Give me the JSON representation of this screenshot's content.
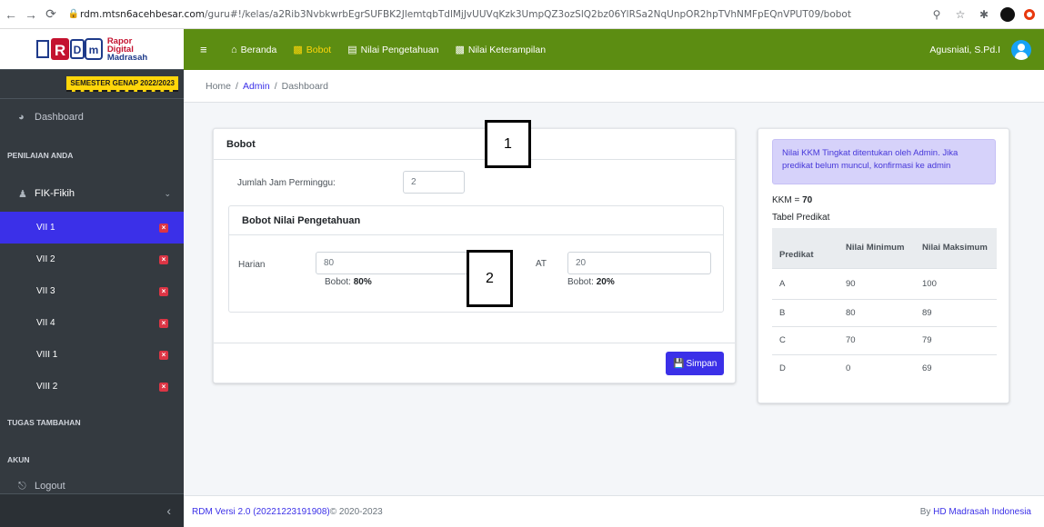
{
  "browser": {
    "url_host": "rdm.mtsn6acehbesar.com",
    "url_path": "/guru#!/kelas/a2Rib3NvbkwrbEgrSUFBK2JlemtqbTdlMjJvUUVqKzk3UmpQZ3ozSlQ2bz06YlRSa2NqUnpOR2hpTVhNMFpEQnVPUT09/bobot",
    "back_icon": "back-arrow-icon",
    "forward_icon": "forward-arrow-icon",
    "reload_icon": "reload-icon"
  },
  "brand": {
    "logo_letters": "RDM",
    "line1": "Rapor",
    "line2": "Digital",
    "line3": "Madrasah"
  },
  "sidebar": {
    "semester": "SEMESTER GENAP 2022/2023",
    "dashboard": "Dashboard",
    "section_penilaian": "PENILAIAN ANDA",
    "group_label": "FIK-Fikih",
    "classes": [
      "VII 1",
      "VII 2",
      "VII 3",
      "VII 4",
      "VIII 1",
      "VIII 2"
    ],
    "section_tugas": "TUGAS TAMBAHAN",
    "section_akun": "AKUN",
    "logout": "Logout"
  },
  "topnav": {
    "beranda": "Beranda",
    "bobot": "Bobot",
    "nilai_pengetahuan": "Nilai Pengetahuan",
    "nilai_keterampilan": "Nilai Keterampilan",
    "user_name": "Agusniati, S.Pd.I"
  },
  "breadcrumb": {
    "home": "Home",
    "admin": "Admin",
    "current": "Dashboard",
    "sep": "/"
  },
  "bobot_card": {
    "title": "Bobot",
    "jam_label": "Jumlah Jam Perminggu:",
    "jam_value": "2",
    "pengetahuan_title": "Bobot Nilai Pengetahuan",
    "harian_label": "Harian",
    "harian_value": "80",
    "harian_bobot_prefix": "Bobot: ",
    "harian_bobot_value": "80%",
    "pat_label": "AT",
    "pat_value": "20",
    "pat_bobot_prefix": "Bobot: ",
    "pat_bobot_value": "20%",
    "save_label": "Simpan"
  },
  "info_card": {
    "alert": "Nilai KKM Tingkat ditentukan oleh Admin. Jika predikat belum muncul, konfirmasi ke admin",
    "kkm_prefix": "KKM = ",
    "kkm_value": "70",
    "table_title": "Tabel Predikat",
    "headers": [
      "Predikat",
      "Nilai Minimum",
      "Nilai Maksimum"
    ],
    "rows": [
      [
        "A",
        "90",
        "100"
      ],
      [
        "B",
        "80",
        "89"
      ],
      [
        "C",
        "70",
        "79"
      ],
      [
        "D",
        "0",
        "69"
      ]
    ]
  },
  "overlays": [
    "1",
    "2"
  ],
  "footer": {
    "version": "RDM Versi 2.0 (20221223191908)",
    "copyright": " © 2020-2023",
    "by_prefix": "By ",
    "by_link": "HD Madrasah Indonesia"
  },
  "colors": {
    "navbar": "#5c8d12",
    "sidebar": "#343a40",
    "accent": "#3b30e8",
    "active_nav": "#ffd60a",
    "badge_red": "#dc3545"
  }
}
